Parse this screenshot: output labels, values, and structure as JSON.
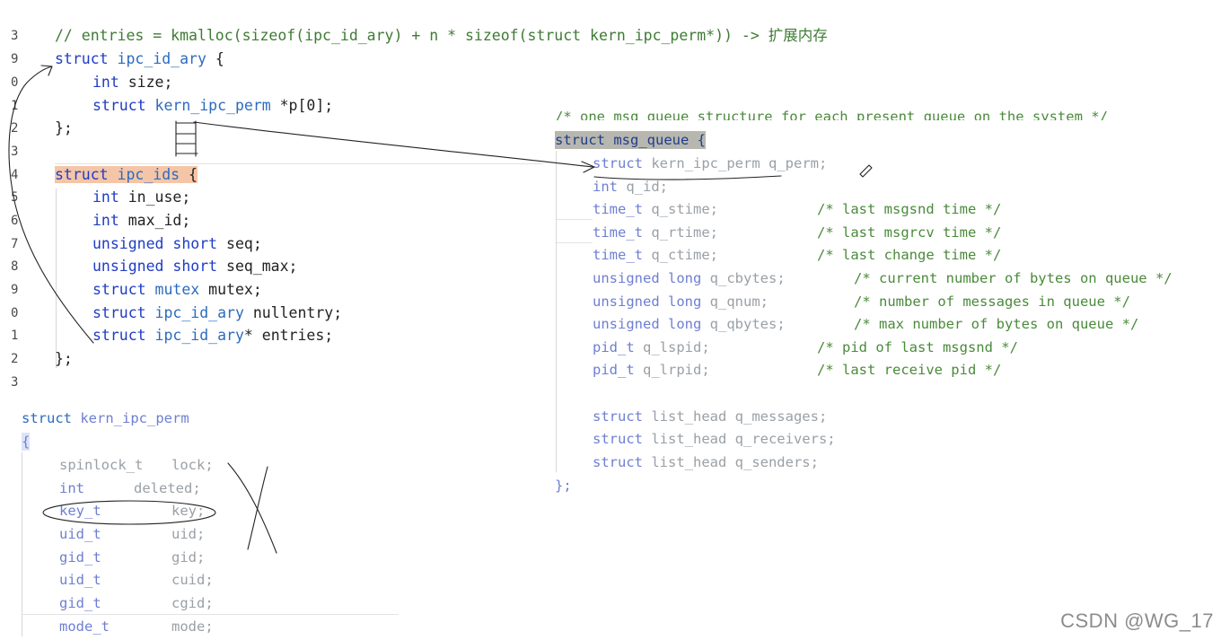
{
  "left_top": {
    "line_numbers": [
      "3",
      "9",
      "0",
      "1",
      "2",
      "3",
      "4",
      "5",
      "6",
      "7",
      "8",
      "9",
      "0",
      "1",
      "2",
      "3"
    ],
    "comment": "// entries = kmalloc(sizeof(ipc_id_ary) + n * sizeof(struct kern_ipc_perm*)) -> 扩展内存",
    "ipc_id_ary": {
      "header_kw": "struct",
      "header_name": "ipc_id_ary",
      "header_brace": " {",
      "fields": [
        {
          "t1": "int",
          "rest": " size;"
        },
        {
          "t1": "struct",
          "t2": " kern_ipc_perm",
          "rest": " *p[0];"
        }
      ],
      "close": "};"
    },
    "ipc_ids": {
      "header_kw": "struct",
      "header_name": "ipc_ids",
      "header_brace": " {",
      "fields": [
        {
          "t1": "int",
          "rest": " in_use;"
        },
        {
          "t1": "int",
          "rest": " max_id;"
        },
        {
          "t1": "unsigned short",
          "rest": " seq;"
        },
        {
          "t1": "unsigned short",
          "rest": " seq_max;"
        },
        {
          "t1": "struct",
          "t2": " mutex",
          "rest": " mutex;"
        },
        {
          "t1": "struct",
          "t2": " ipc_id_ary",
          "rest": " nullentry;"
        },
        {
          "t1": "struct",
          "t2": " ipc_id_ary",
          "rest": "* entries;"
        }
      ],
      "close": "};"
    }
  },
  "kern_ipc_perm": {
    "header_kw": "struct",
    "header_name": "kern_ipc_perm",
    "open": "{",
    "fields": [
      {
        "type": "spinlock_t",
        "name": "lock;"
      },
      {
        "type": "int",
        "name": "deleted;"
      },
      {
        "type": "key_t",
        "name": "key;"
      },
      {
        "type": "uid_t",
        "name": "uid;"
      },
      {
        "type": "gid_t",
        "name": "gid;"
      },
      {
        "type": "uid_t",
        "name": "cuid;"
      },
      {
        "type": "gid_t",
        "name": "cgid;"
      },
      {
        "type": "mode_t",
        "name": "mode;"
      }
    ]
  },
  "msg_queue": {
    "top_comment": "/* one msq_queue structure for each present queue on the system */",
    "header": "struct msg_queue {",
    "fields": [
      {
        "type": "struct",
        "type2": " kern_ipc_perm",
        "name": " q_perm;",
        "comment": ""
      },
      {
        "type": "int",
        "name": " q_id;",
        "comment": ""
      },
      {
        "type": "time_t",
        "name": " q_stime;",
        "comment": "/* last msgsnd time */"
      },
      {
        "type": "time_t",
        "name": " q_rtime;",
        "comment": "/* last msgrcv time */"
      },
      {
        "type": "time_t",
        "name": " q_ctime;",
        "comment": "/* last change time */"
      },
      {
        "type": "unsigned long",
        "name": " q_cbytes;",
        "comment": "/* current number of bytes on queue */"
      },
      {
        "type": "unsigned long",
        "name": " q_qnum;",
        "comment": "/* number of messages in queue */"
      },
      {
        "type": "unsigned long",
        "name": " q_qbytes;",
        "comment": "/* max number of bytes on queue */"
      },
      {
        "type": "pid_t",
        "name": " q_lspid;",
        "comment": "/* pid of last msgsnd */"
      },
      {
        "type": "pid_t",
        "name": " q_lrpid;",
        "comment": "/* last receive pid */"
      }
    ],
    "lists": [
      {
        "type": "struct",
        "name": " list_head q_messages;"
      },
      {
        "type": "struct",
        "name": " list_head q_receivers;"
      },
      {
        "type": "struct",
        "name": " list_head q_senders;"
      }
    ],
    "close": "};"
  },
  "watermark": "CSDN @WG_17"
}
